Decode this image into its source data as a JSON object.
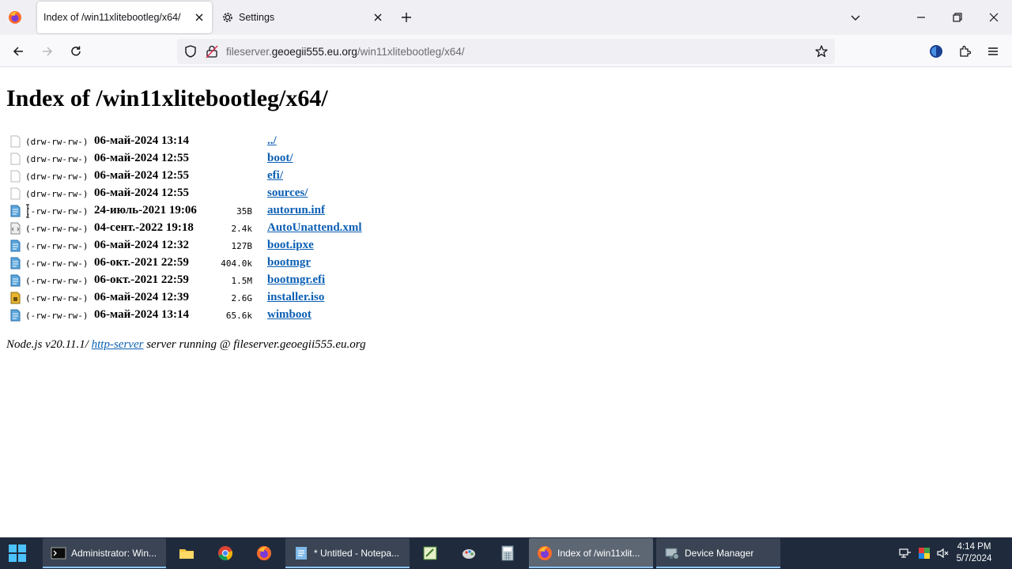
{
  "browser": {
    "tabs": [
      {
        "label": "Index of /win11xlitebootleg/x64/",
        "active": true
      },
      {
        "label": "Settings",
        "active": false
      }
    ],
    "url": {
      "prefix": "fileserver.",
      "domain": "geoegii555.eu.org",
      "path": "/win11xlitebootleg/x64/"
    }
  },
  "page": {
    "title": "Index of /win11xlitebootleg/x64/",
    "entries": [
      {
        "icon": "folder-icon",
        "perms": "(drw-rw-rw-)",
        "date": "06-май-2024 13:14",
        "size": "",
        "name": "../"
      },
      {
        "icon": "folder-icon",
        "perms": "(drw-rw-rw-)",
        "date": "06-май-2024 12:55",
        "size": "",
        "name": "boot/"
      },
      {
        "icon": "folder-icon",
        "perms": "(drw-rw-rw-)",
        "date": "06-май-2024 12:55",
        "size": "",
        "name": "efi/"
      },
      {
        "icon": "folder-icon",
        "perms": "(drw-rw-rw-)",
        "date": "06-май-2024 12:55",
        "size": "",
        "name": "sources/"
      },
      {
        "icon": "text-file-icon",
        "perms": "(-rw-rw-rw-)",
        "date": "24-июль-2021 19:06",
        "size": "35B",
        "name": "autorun.inf"
      },
      {
        "icon": "xml-file-icon",
        "perms": "(-rw-rw-rw-)",
        "date": "04-сент.-2022 19:18",
        "size": "2.4k",
        "name": "AutoUnattend.xml"
      },
      {
        "icon": "text-file-icon",
        "perms": "(-rw-rw-rw-)",
        "date": "06-май-2024 12:32",
        "size": "127B",
        "name": "boot.ipxe"
      },
      {
        "icon": "text-file-icon",
        "perms": "(-rw-rw-rw-)",
        "date": "06-окт.-2021 22:59",
        "size": "404.0k",
        "name": "bootmgr"
      },
      {
        "icon": "text-file-icon",
        "perms": "(-rw-rw-rw-)",
        "date": "06-окт.-2021 22:59",
        "size": "1.5M",
        "name": "bootmgr.efi"
      },
      {
        "icon": "archive-file-icon",
        "perms": "(-rw-rw-rw-)",
        "date": "06-май-2024 12:39",
        "size": "2.6G",
        "name": "installer.iso"
      },
      {
        "icon": "text-file-icon",
        "perms": "(-rw-rw-rw-)",
        "date": "06-май-2024 13:14",
        "size": "65.6k",
        "name": "wimboot"
      }
    ],
    "footer": {
      "prefix": "Node.js v20.11.1/ ",
      "link": "http-server",
      "suffix": " server running @ fileserver.geoegii555.eu.org"
    }
  },
  "taskbar": {
    "items": [
      {
        "label": "Administrator: Win...",
        "icon": "terminal-icon"
      },
      {
        "label": "* Untitled - Notepa...",
        "icon": "notepad-icon"
      },
      {
        "label": "Index of /win11xlit...",
        "icon": "firefox-icon",
        "active": true
      },
      {
        "label": "Device Manager",
        "icon": "device-manager-icon"
      }
    ],
    "clock": {
      "time": "4:14 PM",
      "date": "5/7/2024"
    }
  },
  "colors": {
    "link": "#0b5fb3",
    "taskbar": "#1f2b3d",
    "tabstrip": "#f0f0f4"
  }
}
